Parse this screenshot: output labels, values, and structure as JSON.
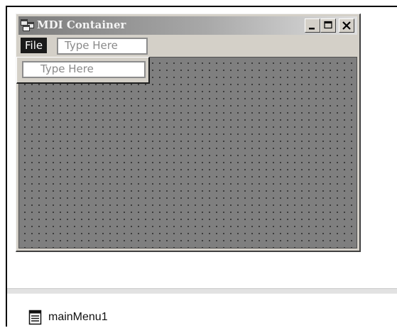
{
  "form": {
    "title": "MDI Container",
    "icon": "mdi-form-icon",
    "controls": {
      "minimize": "minimize-icon",
      "maximize": "maximize-icon",
      "close": "close-icon"
    }
  },
  "menu": {
    "file_label": "File",
    "type_here_top": "Type Here",
    "type_here_sub": "Type Here"
  },
  "tray": {
    "component_icon": "main-menu-component-icon",
    "component_label": "mainMenu1"
  }
}
